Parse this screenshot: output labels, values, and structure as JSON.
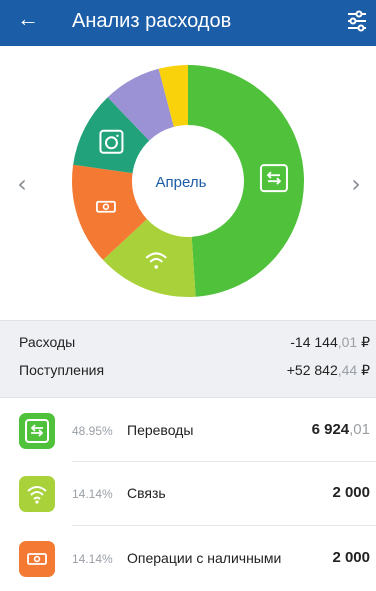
{
  "header": {
    "title": "Анализ расходов",
    "back_icon": "arrow-left-icon",
    "filter_icon": "sliders-icon"
  },
  "chart_data": {
    "type": "pie",
    "center_label": "Апрель",
    "slices": [
      {
        "label": "Переводы",
        "value": 48.95,
        "color": "#4fc13b",
        "icon": "transfer-icon"
      },
      {
        "label": "Связь",
        "value": 14.14,
        "color": "#a9d23a",
        "icon": "wifi-icon"
      },
      {
        "label": "Операции с наличными",
        "value": 14.14,
        "color": "#f47a33",
        "icon": "cash-icon"
      },
      {
        "label": "",
        "value": 10.6,
        "color": "#22a27b",
        "icon": "camera-icon"
      },
      {
        "label": "",
        "value": 8.1,
        "color": "#9a92d4",
        "icon": ""
      },
      {
        "label": "",
        "value": 4.07,
        "color": "#f9d20c",
        "icon": ""
      }
    ]
  },
  "nav": {
    "prev": "‹",
    "next": "›"
  },
  "summary": {
    "expenses": {
      "label": "Расходы",
      "int": "-14 144",
      "dec": ",01",
      "cur": " ₽"
    },
    "income": {
      "label": "Поступления",
      "int": "+52 842",
      "dec": ",44",
      "cur": " ₽"
    }
  },
  "items": [
    {
      "pct": "48.95%",
      "name": "Переводы",
      "amount_int": "6 924",
      "amount_dec": ",01",
      "color": "#4fc13b",
      "icon": "transfer-icon"
    },
    {
      "pct": "14.14%",
      "name": "Связь",
      "amount_int": "2 000",
      "amount_dec": "",
      "color": "#a9d23a",
      "icon": "wifi-icon"
    },
    {
      "pct": "14.14%",
      "name": "Операции с наличными",
      "amount_int": "2 000",
      "amount_dec": "",
      "color": "#f47a33",
      "icon": "cash-icon"
    }
  ]
}
